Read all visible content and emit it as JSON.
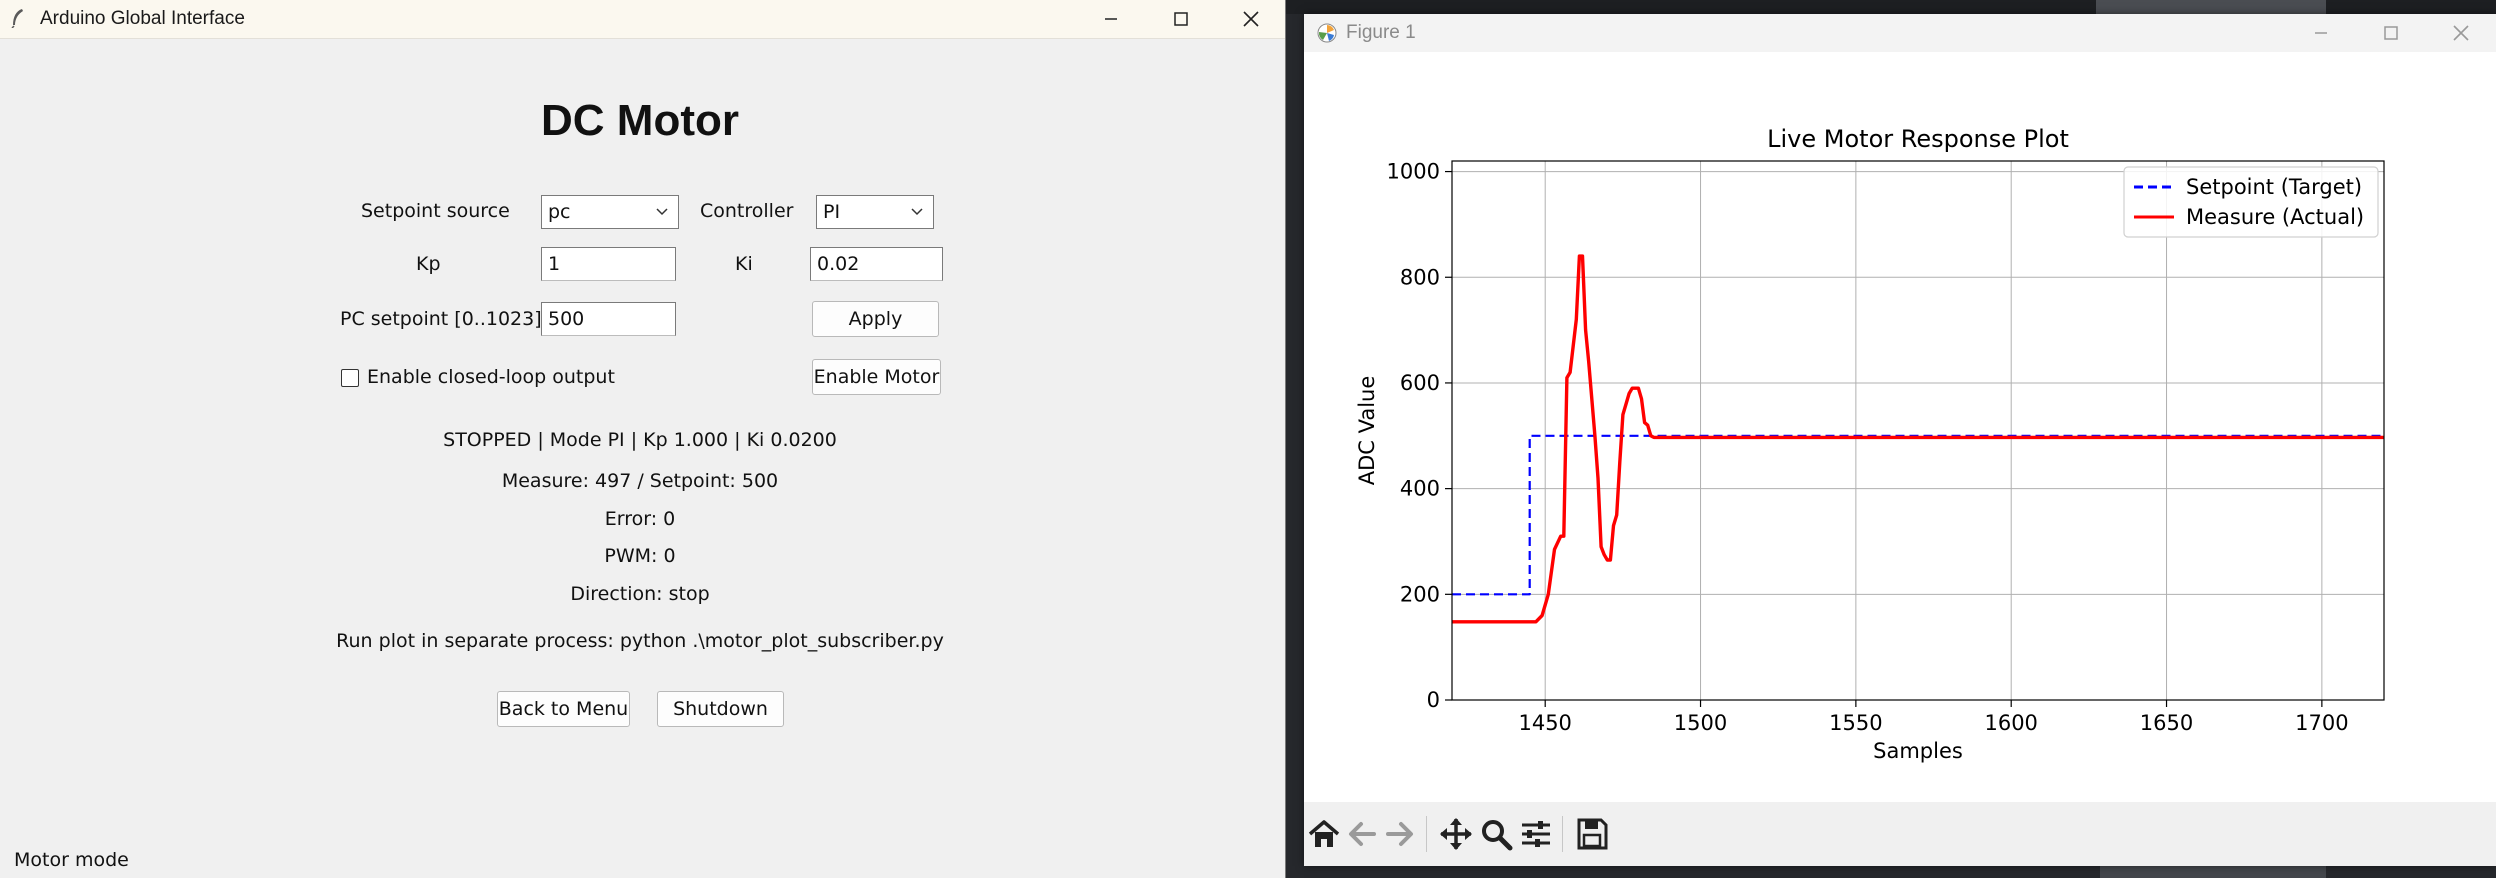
{
  "tk_window": {
    "title": "Arduino Global Interface",
    "heading": "DC Motor",
    "setpoint_source_label": "Setpoint source",
    "setpoint_source_value": "pc",
    "controller_label": "Controller",
    "controller_value": "PI",
    "kp_label": "Kp",
    "kp_value": "1",
    "ki_label": "Ki",
    "ki_value": "0.02",
    "pc_setpoint_label": "PC setpoint [0..1023]",
    "pc_setpoint_value": "500",
    "apply_label": "Apply",
    "enable_closed_loop_label": "Enable closed-loop output",
    "enable_closed_loop_checked": false,
    "enable_motor_label": "Enable Motor",
    "status_line": "STOPPED | Mode PI | Kp 1.000 | Ki 0.0200",
    "measure_line": "Measure: 497 / Setpoint: 500",
    "error_line": "Error: 0",
    "pwm_line": "PWM: 0",
    "direction_line": "Direction: stop",
    "hint_line": "Run plot in separate process: python .\\motor_plot_subscriber.py",
    "back_label": "Back to Menu",
    "shutdown_label": "Shutdown",
    "status_bar": "Motor mode"
  },
  "mpl_window": {
    "title": "Figure 1",
    "toolbar_icons": [
      "home-icon",
      "back-arrow-icon",
      "forward-arrow-icon",
      "pan-icon",
      "zoom-icon",
      "configure-subplots-icon",
      "save-icon"
    ]
  },
  "chart_data": {
    "type": "line",
    "title": "Live Motor Response Plot",
    "xlabel": "Samples",
    "ylabel": "ADC Value",
    "xlim": [
      1420,
      1720
    ],
    "ylim": [
      0,
      1020
    ],
    "xticks": [
      1450,
      1500,
      1550,
      1600,
      1650,
      1700
    ],
    "yticks": [
      0,
      200,
      400,
      600,
      800,
      1000
    ],
    "grid": true,
    "legend_position": "top-right",
    "series": [
      {
        "name": "Setpoint (Target)",
        "color": "#0000ff",
        "style": "dashed",
        "points": [
          [
            1420,
            200
          ],
          [
            1445,
            200
          ],
          [
            1445,
            500
          ],
          [
            1720,
            500
          ]
        ]
      },
      {
        "name": "Measure (Actual)",
        "color": "#ff0000",
        "style": "solid",
        "points": [
          [
            1420,
            148
          ],
          [
            1447,
            148
          ],
          [
            1449,
            160
          ],
          [
            1451,
            200
          ],
          [
            1453,
            285
          ],
          [
            1455,
            310
          ],
          [
            1456,
            310
          ],
          [
            1457,
            610
          ],
          [
            1458,
            620
          ],
          [
            1460,
            720
          ],
          [
            1461,
            840
          ],
          [
            1462,
            840
          ],
          [
            1463,
            700
          ],
          [
            1464,
            640
          ],
          [
            1466,
            500
          ],
          [
            1467,
            420
          ],
          [
            1468,
            290
          ],
          [
            1469,
            275
          ],
          [
            1470,
            265
          ],
          [
            1471,
            265
          ],
          [
            1472,
            330
          ],
          [
            1473,
            350
          ],
          [
            1474,
            450
          ],
          [
            1475,
            540
          ],
          [
            1476,
            560
          ],
          [
            1477,
            580
          ],
          [
            1478,
            590
          ],
          [
            1480,
            590
          ],
          [
            1481,
            570
          ],
          [
            1482,
            525
          ],
          [
            1483,
            520
          ],
          [
            1484,
            500
          ],
          [
            1485,
            497
          ],
          [
            1720,
            497
          ]
        ]
      }
    ]
  }
}
